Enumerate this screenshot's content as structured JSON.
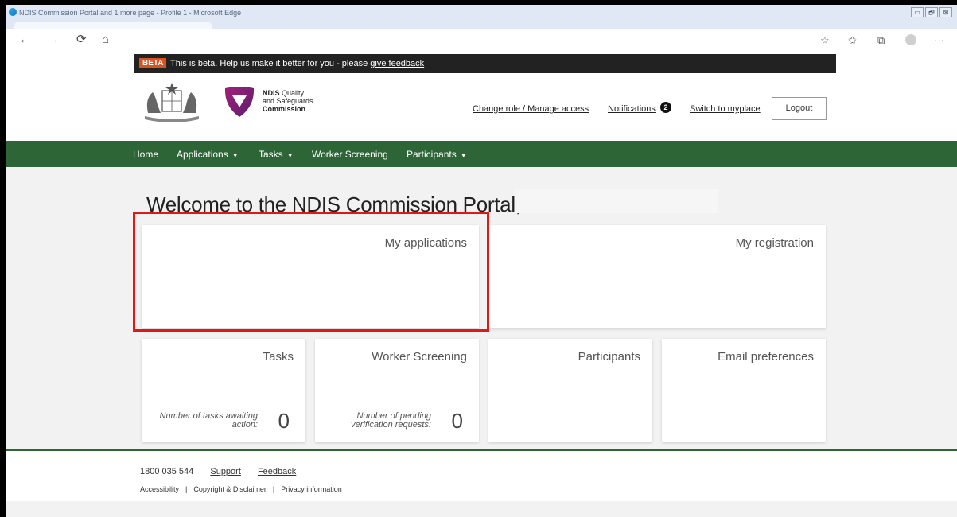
{
  "browser": {
    "window_title": "NDIS Commission Portal and 1 more page - Profile 1 - Microsoft Edge",
    "window_buttons": [
      "▭",
      "🗗",
      "⊠"
    ],
    "nav_icons": {
      "back": "←",
      "forward": "→",
      "refresh": "⟳",
      "home": "⌂"
    },
    "right_icons": {
      "favorite_add": "☆",
      "favorites": "✩",
      "collections": "⧉",
      "more": "···"
    }
  },
  "beta_bar": {
    "badge": "BETA",
    "message": "This is beta. Help us make it better for you - please ",
    "link": "give feedback"
  },
  "brand": {
    "line1": "NDIS",
    "line1_rest": " Quality",
    "line2": "and Safeguards",
    "line3": "Commission"
  },
  "header_links": {
    "change_role": "Change role / Manage access",
    "notifications": "Notifications",
    "notifications_count": "2",
    "switch": "Switch to myplace",
    "logout": "Logout"
  },
  "nav": {
    "items": [
      {
        "label": "Home",
        "caret": ""
      },
      {
        "label": "Applications",
        "caret": "▼"
      },
      {
        "label": "Tasks",
        "caret": "▼"
      },
      {
        "label": "Worker Screening",
        "caret": ""
      },
      {
        "label": "Participants",
        "caret": "▼"
      }
    ]
  },
  "welcome": "Welcome to the NDIS Commission Portal,",
  "cards": {
    "my_applications": "My applications",
    "my_registration": "My registration",
    "tasks": {
      "title": "Tasks",
      "caption": "Number of tasks awaiting action:",
      "count": "0"
    },
    "worker_screening": {
      "title": "Worker Screening",
      "caption": "Number of pending verification requests:",
      "count": "0"
    },
    "participants": "Participants",
    "email_preferences": "Email preferences"
  },
  "footer": {
    "phone": "1800 035 544",
    "support": "Support",
    "feedback": "Feedback",
    "accessibility": "Accessibility",
    "copyright": "Copyright & Disclaimer",
    "privacy": "Privacy information",
    "separator": "|"
  },
  "colors": {
    "nav_green": "#2e6537",
    "beta_orange": "#d9531e",
    "highlight_red": "#e11818"
  }
}
